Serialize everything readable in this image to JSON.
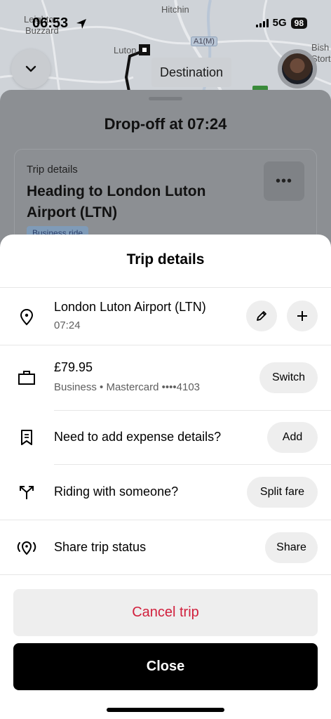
{
  "status_bar": {
    "time": "06:53",
    "network": "5G",
    "battery": "98"
  },
  "map": {
    "labels": [
      "Leighton",
      "Buzzard",
      "Hitchin",
      "Luton",
      "Bish",
      "Stort"
    ],
    "road_badge": "A1(M)"
  },
  "header": {
    "destination_label": "Destination"
  },
  "underlying": {
    "dropoff_text": "Drop-off at 07:24",
    "card_label": "Trip details",
    "card_title": "Heading to London Luton Airport (LTN)",
    "more_label": "•••",
    "badge": "Business ride"
  },
  "modal": {
    "title": "Trip details",
    "rows": [
      {
        "icon": "location-pin-icon",
        "primary": "London Luton Airport (LTN)",
        "secondary": "07:24"
      },
      {
        "icon": "briefcase-icon",
        "primary": "£79.95",
        "secondary": "Business • Mastercard ••••4103",
        "action": "Switch"
      },
      {
        "icon": "receipt-icon",
        "primary": "Need to add expense details?",
        "action": "Add"
      },
      {
        "icon": "split-arrows-icon",
        "primary": "Riding with someone?",
        "action": "Split fare"
      },
      {
        "icon": "share-location-icon",
        "primary": "Share trip status",
        "action": "Share"
      }
    ],
    "cancel_label": "Cancel trip",
    "close_label": "Close"
  },
  "colors": {
    "cancel_text": "#d11f3c",
    "close_bg": "#000000",
    "pill_bg": "#eeeeee"
  }
}
